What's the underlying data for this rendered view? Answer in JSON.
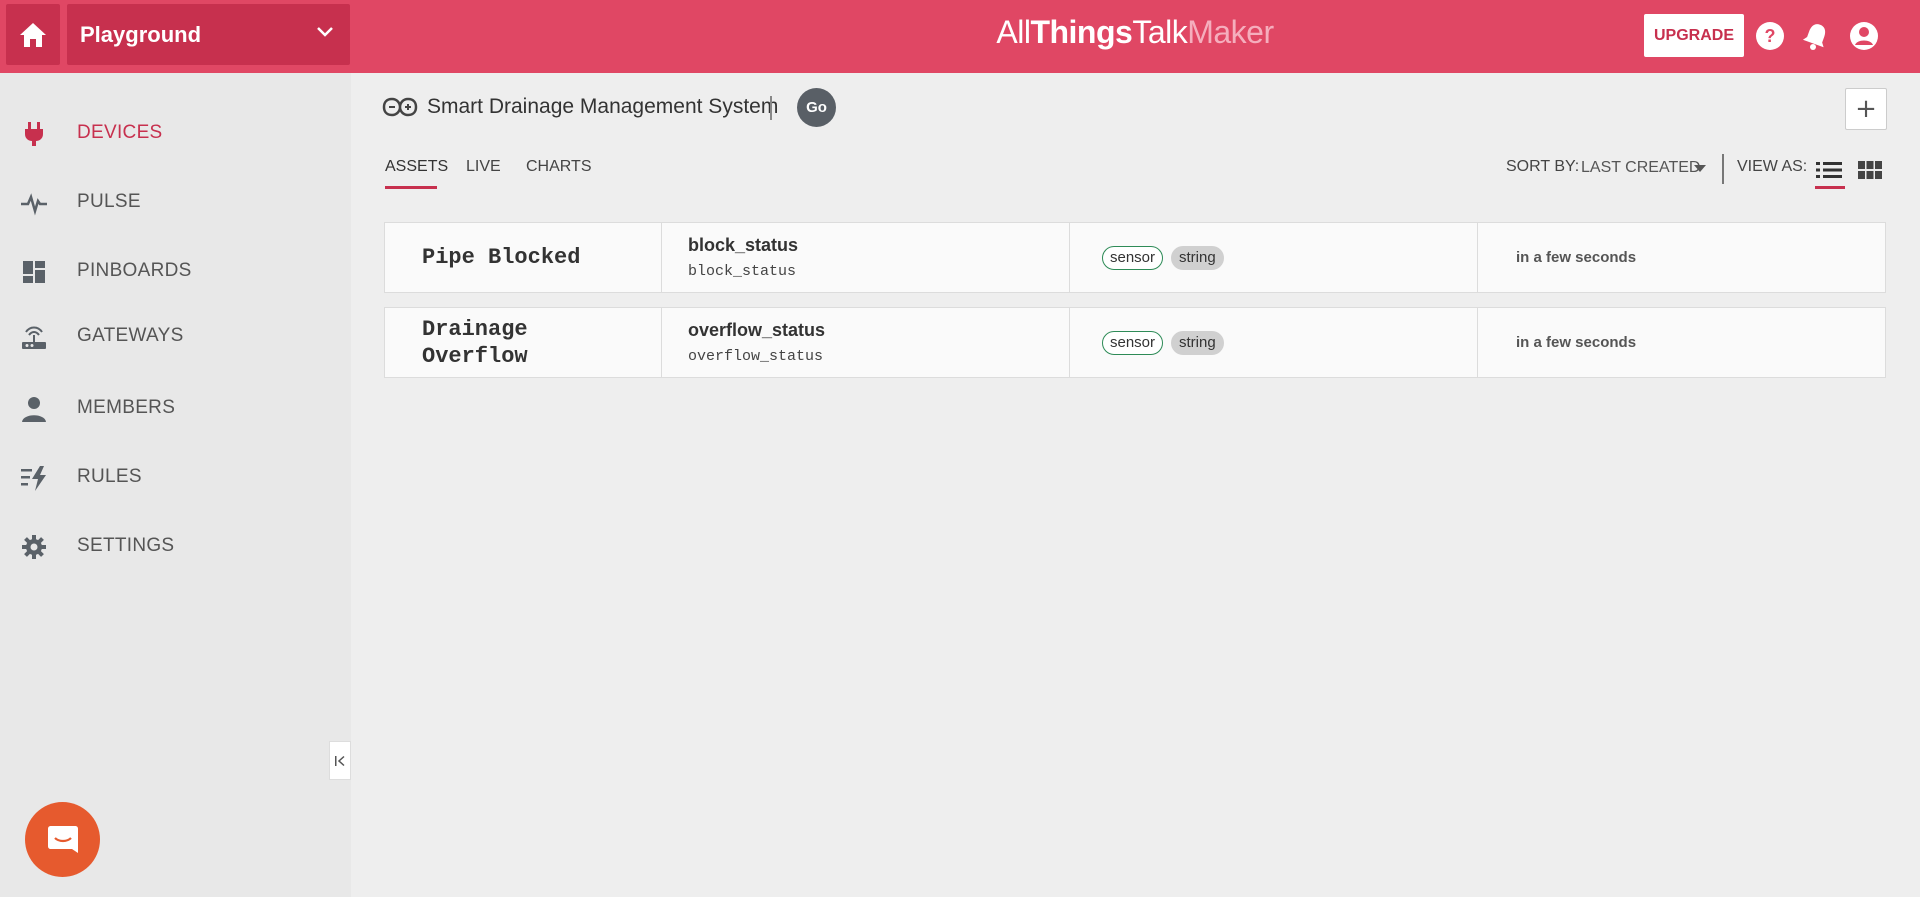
{
  "header": {
    "ground": "Playground",
    "logo": {
      "part1": "All",
      "part2": "Things",
      "part3": "Talk",
      "part4": "Maker"
    },
    "upgrade_label": "UPGRADE"
  },
  "sidebar": {
    "items": [
      {
        "label": "DEVICES",
        "icon": "plug-icon",
        "active": true
      },
      {
        "label": "PULSE",
        "icon": "pulse-icon"
      },
      {
        "label": "PINBOARDS",
        "icon": "dashboard-icon"
      },
      {
        "label": "GATEWAYS",
        "icon": "router-icon"
      },
      {
        "label": "MEMBERS",
        "icon": "person-icon"
      },
      {
        "label": "RULES",
        "icon": "rules-icon"
      },
      {
        "label": "SETTINGS",
        "icon": "gear-icon"
      }
    ]
  },
  "device": {
    "title": "Smart Drainage Management System",
    "badge": "Go"
  },
  "tabs": [
    "ASSETS",
    "LIVE",
    "CHARTS"
  ],
  "toolbar": {
    "sort_label": "SORT BY:",
    "sort_value": "LAST CREATED",
    "view_label": "VIEW AS:"
  },
  "assets": [
    {
      "title_line1": "Pipe Blocked",
      "title_line2": "",
      "name": "block_status",
      "id": "block_status",
      "kind": "sensor",
      "type": "string",
      "updated": "in a few seconds"
    },
    {
      "title_line1": "Drainage",
      "title_line2": "Overflow",
      "name": "overflow_status",
      "id": "overflow_status",
      "kind": "sensor",
      "type": "string",
      "updated": "in a few seconds"
    }
  ],
  "colors": {
    "brand": "#e04764",
    "brand_dark": "#c7304e",
    "chat": "#e65a2e"
  }
}
